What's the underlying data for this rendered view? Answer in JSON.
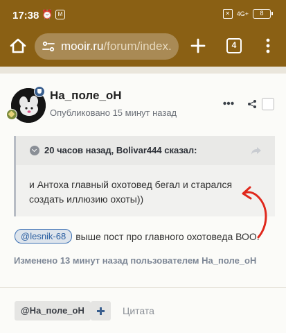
{
  "status": {
    "time": "17:38",
    "sim_label": "M",
    "network": "4G+",
    "battery": "8"
  },
  "browser": {
    "url_host": "mooir.ru",
    "url_path": "/forum/index.",
    "tab_count": "4"
  },
  "post": {
    "author": "На_поле_оН",
    "published": "Опубликовано 15 минут назад",
    "quote": {
      "cite": "20 часов назад, Bolivar444 сказал:",
      "text": " и Антоха главный охотовед бегал и старался создать иллюзию охоты))"
    },
    "mention": "@lesnik-68",
    "body_text": "выше пост про главного охотоведа ВОО.",
    "edited": "Изменено 13 минут назад пользователем На_поле_оН"
  },
  "footer": {
    "tag_label": "@На_поле_оН",
    "quote_label": "Цитата"
  },
  "colors": {
    "toolbar": "#8a6014",
    "accent": "#3a5f8e",
    "annotation_arrow": "#e0281c"
  },
  "icons": [
    "home-icon",
    "site-settings-icon",
    "plus-icon",
    "tabs-icon",
    "menu-icon",
    "more-icon",
    "share-icon",
    "chevron-down-icon",
    "reply-arrow-icon"
  ]
}
